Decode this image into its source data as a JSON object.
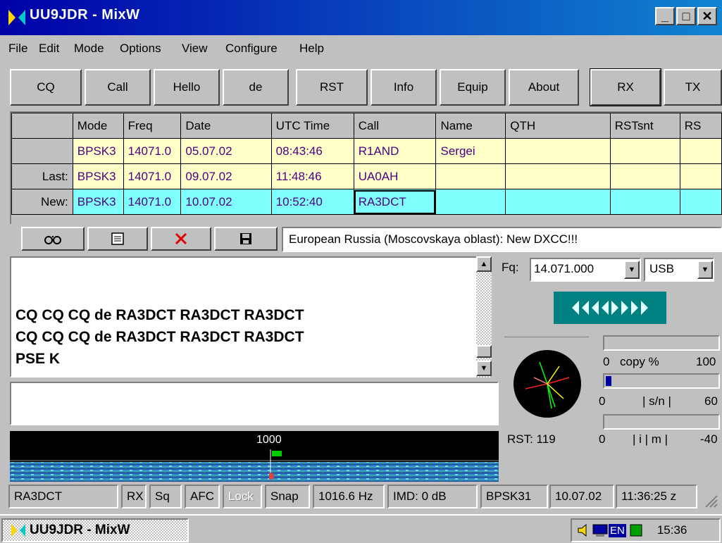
{
  "window": {
    "title": "UU9JDR - MixW"
  },
  "menu": [
    "File",
    "Edit",
    "Mode",
    "Options",
    "View",
    "Configure",
    "Help"
  ],
  "toolbar": [
    "CQ",
    "Call",
    "Hello",
    "de",
    "RST",
    "Info",
    "Equip",
    "About",
    "RX",
    "TX"
  ],
  "log": {
    "headers": [
      "",
      "Mode",
      "Freq",
      "Date",
      "UTC Time",
      "Call",
      "Name",
      "QTH",
      "RSTsnt",
      "RS"
    ],
    "rows": [
      {
        "label": "",
        "cells": [
          "BPSK3",
          "14071.0",
          "05.07.02",
          "08:43:46",
          "R1AND",
          "Sergei",
          "",
          "",
          ""
        ]
      },
      {
        "label": "Last:",
        "cells": [
          "BPSK3",
          "14071.0",
          "09.07.02",
          "11:48:46",
          "UA0AH",
          "",
          "",
          "",
          ""
        ]
      },
      {
        "label": "New:",
        "cells": [
          "BPSK3",
          "14071.0",
          "10.07.02",
          "10:52:40",
          "RA3DCT",
          "",
          "",
          "",
          ""
        ]
      }
    ]
  },
  "info_bar": "European Russia (Moscovskaya oblast):  New DXCC!!!",
  "rx_lines": [
    "CQ CQ CQ de RA3DCT RA3DCT RA3DCT",
    "CQ CQ CQ de RA3DCT RA3DCT RA3DCT",
    "PSE K"
  ],
  "freq": {
    "label": "Fq:",
    "value": "14.071.000",
    "mode": "USB"
  },
  "meters": {
    "copy": {
      "min": "0",
      "label": "copy %",
      "max": "100",
      "level": 0
    },
    "sn": {
      "min": "0",
      "label": "| s/n |",
      "max": "60",
      "level": 0.05
    },
    "imd": {
      "min": "0",
      "label": "| i  | m |",
      "max": "-40",
      "level": 0
    }
  },
  "rst": "RST: 119",
  "waterfall": {
    "marker": "1000"
  },
  "status": [
    "RA3DCT",
    "RX",
    "Sq",
    "AFC",
    "Lock",
    "Snap",
    "1016.6 Hz",
    "IMD: 0 dB",
    "BPSK31",
    "10.07.02",
    "11:36:25 z"
  ],
  "taskbar": {
    "app": "UU9JDR - MixW",
    "lang": "EN",
    "clock": "15:36"
  },
  "colors": {
    "title_start": "#0000a8",
    "log_yellow": "#ffffc8",
    "log_cyan": "#80ffff",
    "tuning": "#008080"
  }
}
